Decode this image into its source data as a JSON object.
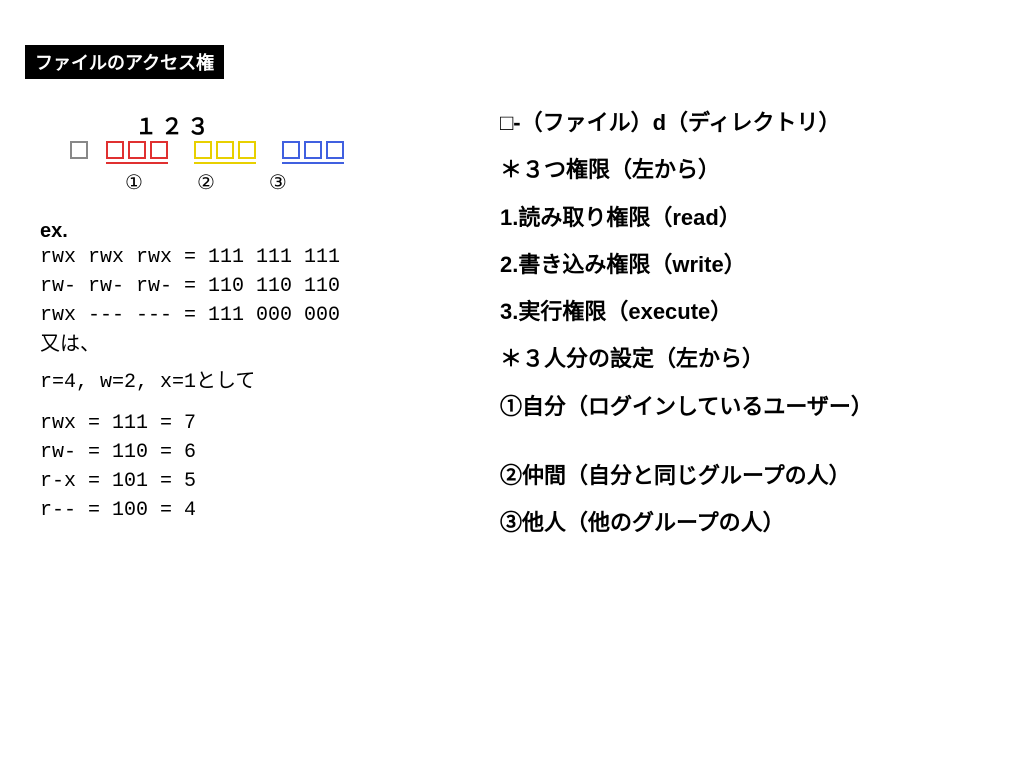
{
  "header": {
    "badge": "ファイルのアクセス権"
  },
  "diagram": {
    "numbers": "１２３",
    "circled": [
      "①",
      "②",
      "③"
    ]
  },
  "left": {
    "ex_label": "ex.",
    "examples1": "rwx rwx rwx = 111 111 111\nrw- rw- rw- = 110 110 110\nrwx --- --- = 111 000 000",
    "or_text": "又は、",
    "eq_line_pre": "r=4, w=2, x=1",
    "eq_line_suf": "として",
    "examples2": "rwx = 111 = 7\nrw- = 110 = 6\nr-x = 101 = 5\nr-- = 100 = 4"
  },
  "right": {
    "line1": "□-（ファイル）d（ディレクトリ）",
    "line2": "＊３つ権限（左から）",
    "line3": "1.読み取り権限（read）",
    "line4": "2.書き込み権限（write）",
    "line5": "3.実行権限（execute）",
    "line6": "＊３人分の設定（左から）",
    "line7": "①自分（ログインしているユーザー）",
    "line8": "②仲間（自分と同じグループの人）",
    "line9": "③他人（他のグループの人）"
  }
}
